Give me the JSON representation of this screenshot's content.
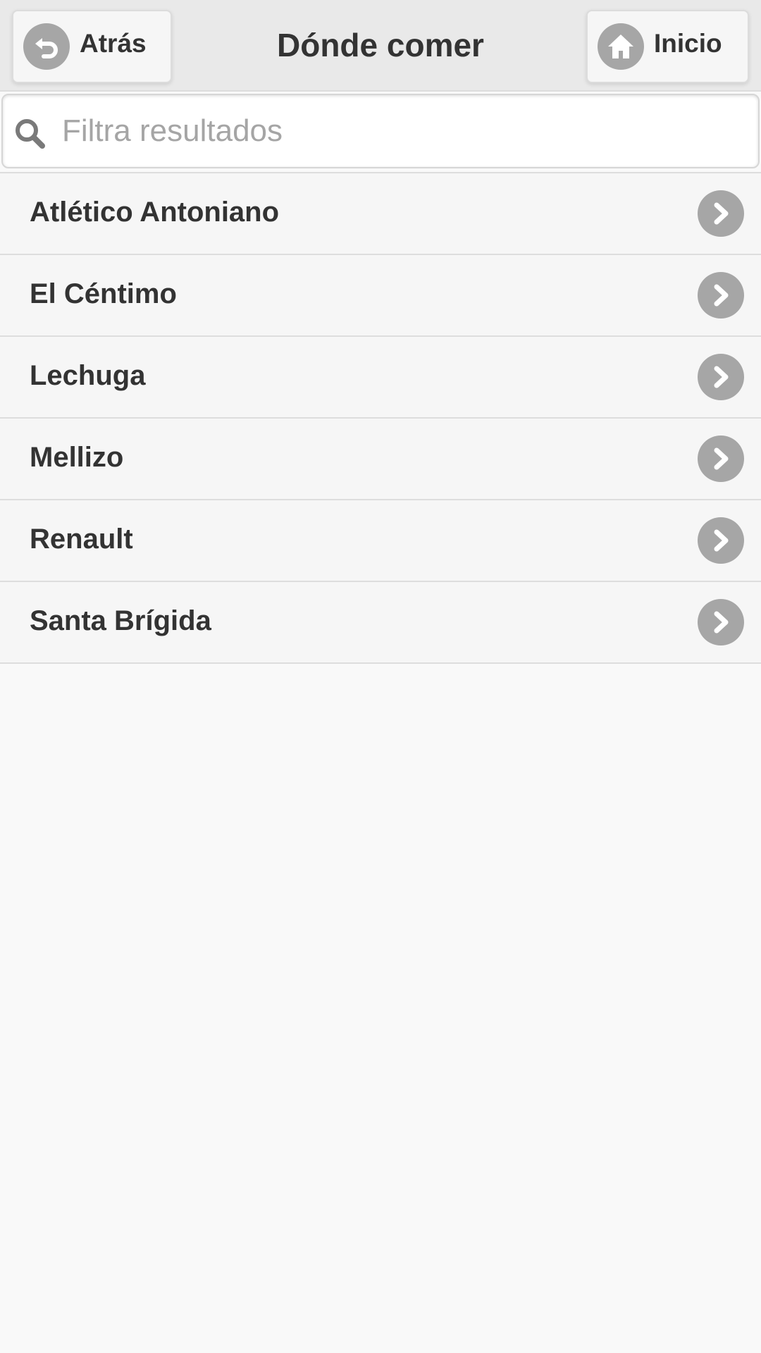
{
  "header": {
    "title": "Dónde comer",
    "back_label": "Atrás",
    "home_label": "Inicio",
    "back_icon": "back-arrow-icon",
    "home_icon": "home-icon"
  },
  "search": {
    "placeholder": "Filtra resultados",
    "value": "",
    "icon": "search-icon"
  },
  "list": {
    "items": [
      {
        "label": "Atlético Antoniano"
      },
      {
        "label": "El Céntimo"
      },
      {
        "label": "Lechuga"
      },
      {
        "label": "Mellizo"
      },
      {
        "label": "Renault"
      },
      {
        "label": "Santa Brígida"
      }
    ],
    "item_icon": "chevron-right-icon"
  },
  "colors": {
    "header_bg": "#e9e9e9",
    "icon_circle": "#a6a6a6",
    "text": "#333333",
    "placeholder": "#a5a5a5",
    "page_bg": "#f9f9f9"
  }
}
